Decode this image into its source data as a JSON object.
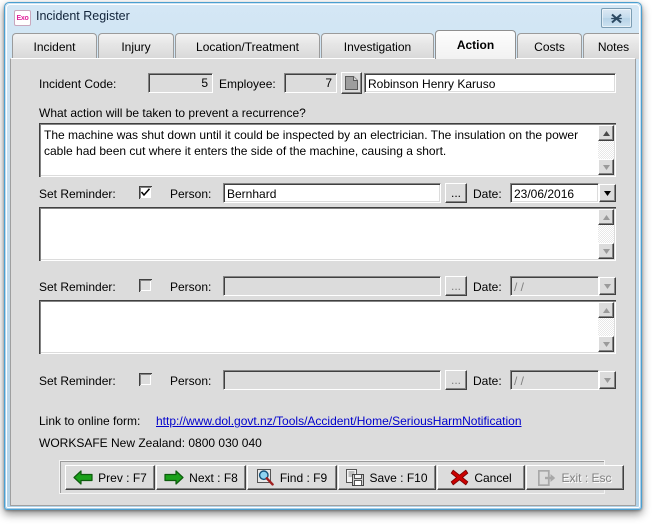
{
  "window": {
    "title": "Incident Register",
    "app_icon": "exo-logo-icon",
    "close_label": "×"
  },
  "tabs": [
    {
      "label": "Incident",
      "active": false
    },
    {
      "label": "Injury",
      "active": false
    },
    {
      "label": "Location/Treatment",
      "active": false
    },
    {
      "label": "Investigation",
      "active": false
    },
    {
      "label": "Action",
      "active": true
    },
    {
      "label": "Costs",
      "active": false
    },
    {
      "label": "Notes",
      "active": false
    }
  ],
  "header": {
    "incident_code_label": "Incident Code:",
    "incident_code_value": "5",
    "employee_label": "Employee:",
    "employee_code_value": "7",
    "employee_name_value": "Robinson Henry Karuso"
  },
  "question": {
    "label": "What action will be taken to prevent a recurrence?",
    "answer": "The machine was shut down until it could be inspected by an electrician. The insulation on the power cable had been cut where it enters the side of the machine, causing a short."
  },
  "reminders": [
    {
      "set_label": "Set Reminder:",
      "checked": true,
      "person_label": "Person:",
      "person_value": "Bernhard",
      "browse_label": "...",
      "date_label": "Date:",
      "date_value": "23/06/2016",
      "enabled": true,
      "note": ""
    },
    {
      "set_label": "Set Reminder:",
      "checked": false,
      "person_label": "Person:",
      "person_value": "",
      "browse_label": "...",
      "date_label": "Date:",
      "date_value": "  /  /",
      "enabled": false,
      "note": ""
    },
    {
      "set_label": "Set Reminder:",
      "checked": false,
      "person_label": "Person:",
      "person_value": "",
      "browse_label": "...",
      "date_label": "Date:",
      "date_value": "  /  /",
      "enabled": false,
      "note": ""
    }
  ],
  "footer": {
    "link_label": "Link to online form:",
    "link_url": "http://www.dol.govt.nz/Tools/Accident/Home/SeriousHarmNotification",
    "contact_line": "WORKSAFE New Zealand: 0800 030 040"
  },
  "toolbar": {
    "prev_label": "Prev : F7",
    "next_label": "Next : F8",
    "find_label": "Find : F9",
    "save_label": "Save : F10",
    "cancel_label": "Cancel",
    "exit_label": "Exit : Esc"
  },
  "colors": {
    "link": "#0000cc",
    "face": "#dcdcdc",
    "title_accent": "#4a9fd0",
    "green_arrow": "#1aa11a",
    "red_cross": "#cc0000",
    "logo_pink": "#e0219b"
  }
}
